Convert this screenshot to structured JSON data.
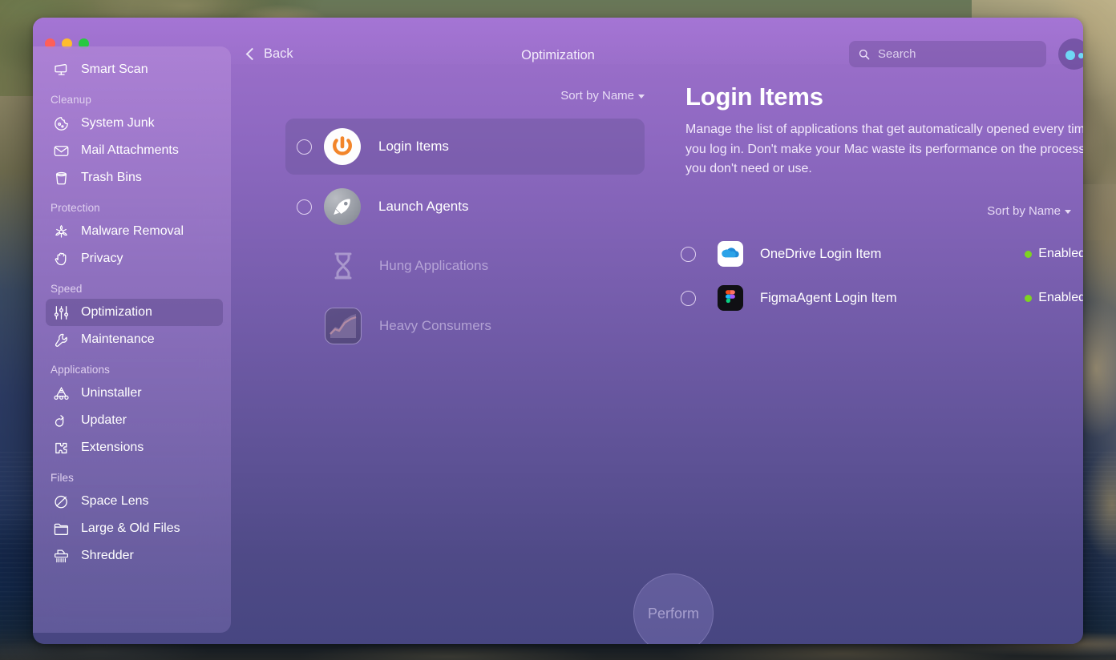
{
  "window": {
    "title": "Optimization",
    "back_label": "Back",
    "traffic_lights": [
      "close",
      "minimize",
      "zoom"
    ]
  },
  "search": {
    "placeholder": "Search",
    "value": ""
  },
  "sidebar": {
    "top_item": {
      "label": "Smart Scan",
      "icon": "smart-scan-icon"
    },
    "groups": [
      {
        "label": "Cleanup",
        "items": [
          {
            "label": "System Junk",
            "icon": "system-junk-icon"
          },
          {
            "label": "Mail Attachments",
            "icon": "mail-icon"
          },
          {
            "label": "Trash Bins",
            "icon": "trash-icon"
          }
        ]
      },
      {
        "label": "Protection",
        "items": [
          {
            "label": "Malware Removal",
            "icon": "biohazard-icon"
          },
          {
            "label": "Privacy",
            "icon": "hand-icon"
          }
        ]
      },
      {
        "label": "Speed",
        "items": [
          {
            "label": "Optimization",
            "icon": "sliders-icon",
            "selected": true
          },
          {
            "label": "Maintenance",
            "icon": "wrench-icon"
          }
        ]
      },
      {
        "label": "Applications",
        "items": [
          {
            "label": "Uninstaller",
            "icon": "uninstaller-icon"
          },
          {
            "label": "Updater",
            "icon": "updater-arrow-icon"
          },
          {
            "label": "Extensions",
            "icon": "puzzle-icon"
          }
        ]
      },
      {
        "label": "Files",
        "items": [
          {
            "label": "Space Lens",
            "icon": "space-lens-icon"
          },
          {
            "label": "Large & Old Files",
            "icon": "folder-icon"
          },
          {
            "label": "Shredder",
            "icon": "shredder-icon"
          }
        ]
      }
    ]
  },
  "middle": {
    "sort_label": "Sort by Name",
    "rows": [
      {
        "label": "Login Items",
        "icon": "power-button-icon",
        "selected": true,
        "selectable": true
      },
      {
        "label": "Launch Agents",
        "icon": "rocket-icon",
        "selected": false,
        "selectable": true
      },
      {
        "label": "Hung Applications",
        "icon": "hourglass-icon",
        "selected": false,
        "selectable": false
      },
      {
        "label": "Heavy Consumers",
        "icon": "activity-monitor-icon",
        "selected": false,
        "selectable": false
      }
    ]
  },
  "detail": {
    "title": "Login Items",
    "description": "Manage the list of applications that get automatically opened every time you log in. Don't make your Mac waste its performance on the processes you don't need or use.",
    "sort_label": "Sort by Name",
    "items": [
      {
        "name": "OneDrive Login Item",
        "icon": "onedrive-icon",
        "status": "Enabled",
        "status_color": "#7ed321"
      },
      {
        "name": "FigmaAgent Login Item",
        "icon": "figma-icon",
        "status": "Enabled",
        "status_color": "#7ed321"
      }
    ]
  },
  "footer": {
    "perform_label": "Perform"
  },
  "colors": {
    "accent_purple": "#8f69c2",
    "window_top": "#a071d0",
    "window_bottom": "#474681",
    "status_green": "#7ed321",
    "power_orange": "#f2852a"
  }
}
